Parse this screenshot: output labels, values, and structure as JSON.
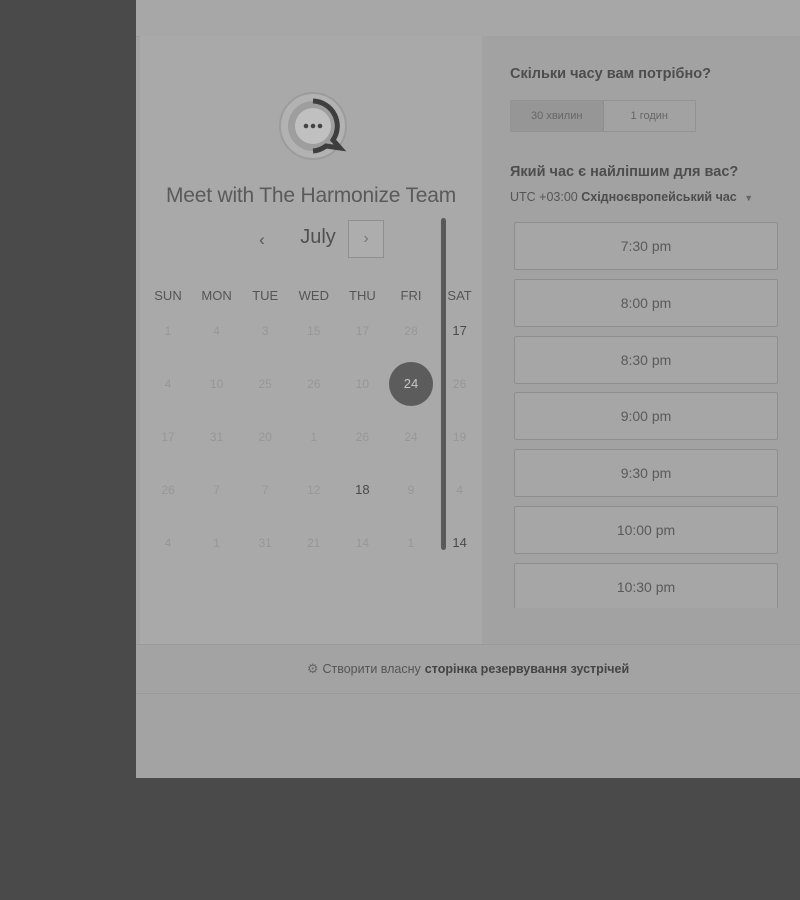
{
  "meeting": {
    "title": "Meet with The Harmonize Team",
    "avatar_icon": "chat-bubble-icon"
  },
  "calendar": {
    "month": "July",
    "prev_icon": "‹",
    "next_icon": "›",
    "weekdays": [
      "SUN",
      "MON",
      "TUE",
      "WED",
      "THU",
      "FRI",
      "SAT"
    ],
    "weeks": [
      [
        {
          "d": "1",
          "a": false
        },
        {
          "d": "4",
          "a": false
        },
        {
          "d": "3",
          "a": false
        },
        {
          "d": "15",
          "a": false
        },
        {
          "d": "17",
          "a": false
        },
        {
          "d": "28",
          "a": false
        },
        {
          "d": "17",
          "a": true
        }
      ],
      [
        {
          "d": "4",
          "a": false
        },
        {
          "d": "10",
          "a": false
        },
        {
          "d": "25",
          "a": false
        },
        {
          "d": "26",
          "a": false
        },
        {
          "d": "10",
          "a": false
        },
        {
          "d": "24",
          "a": true,
          "selected": true
        },
        {
          "d": "26",
          "a": false
        }
      ],
      [
        {
          "d": "17",
          "a": false
        },
        {
          "d": "31",
          "a": false
        },
        {
          "d": "20",
          "a": false
        },
        {
          "d": "1",
          "a": false
        },
        {
          "d": "26",
          "a": false
        },
        {
          "d": "24",
          "a": false
        },
        {
          "d": "19",
          "a": false
        }
      ],
      [
        {
          "d": "26",
          "a": false
        },
        {
          "d": "7",
          "a": false
        },
        {
          "d": "7",
          "a": false
        },
        {
          "d": "12",
          "a": false
        },
        {
          "d": "18",
          "a": true
        },
        {
          "d": "9",
          "a": false
        },
        {
          "d": "4",
          "a": false
        }
      ],
      [
        {
          "d": "4",
          "a": false
        },
        {
          "d": "1",
          "a": false
        },
        {
          "d": "31",
          "a": false
        },
        {
          "d": "21",
          "a": false
        },
        {
          "d": "14",
          "a": false
        },
        {
          "d": "1",
          "a": false
        },
        {
          "d": "14",
          "a": true
        }
      ]
    ]
  },
  "booking": {
    "duration_question": "Скільки часу вам потрібно?",
    "durations": [
      "30 хвилин",
      "1 годин"
    ],
    "time_question": "Який час є найліпшим для вас?",
    "timezone_offset": "UTC +03:00",
    "timezone_name": "Східноєвропейський час",
    "slots": [
      "7:30 pm",
      "8:00 pm",
      "8:30 pm",
      "9:00 pm",
      "9:30 pm",
      "10:00 pm",
      "10:30 pm"
    ]
  },
  "footer": {
    "prefix": "Створити власну",
    "link": "сторінка резервування зустрічей"
  }
}
